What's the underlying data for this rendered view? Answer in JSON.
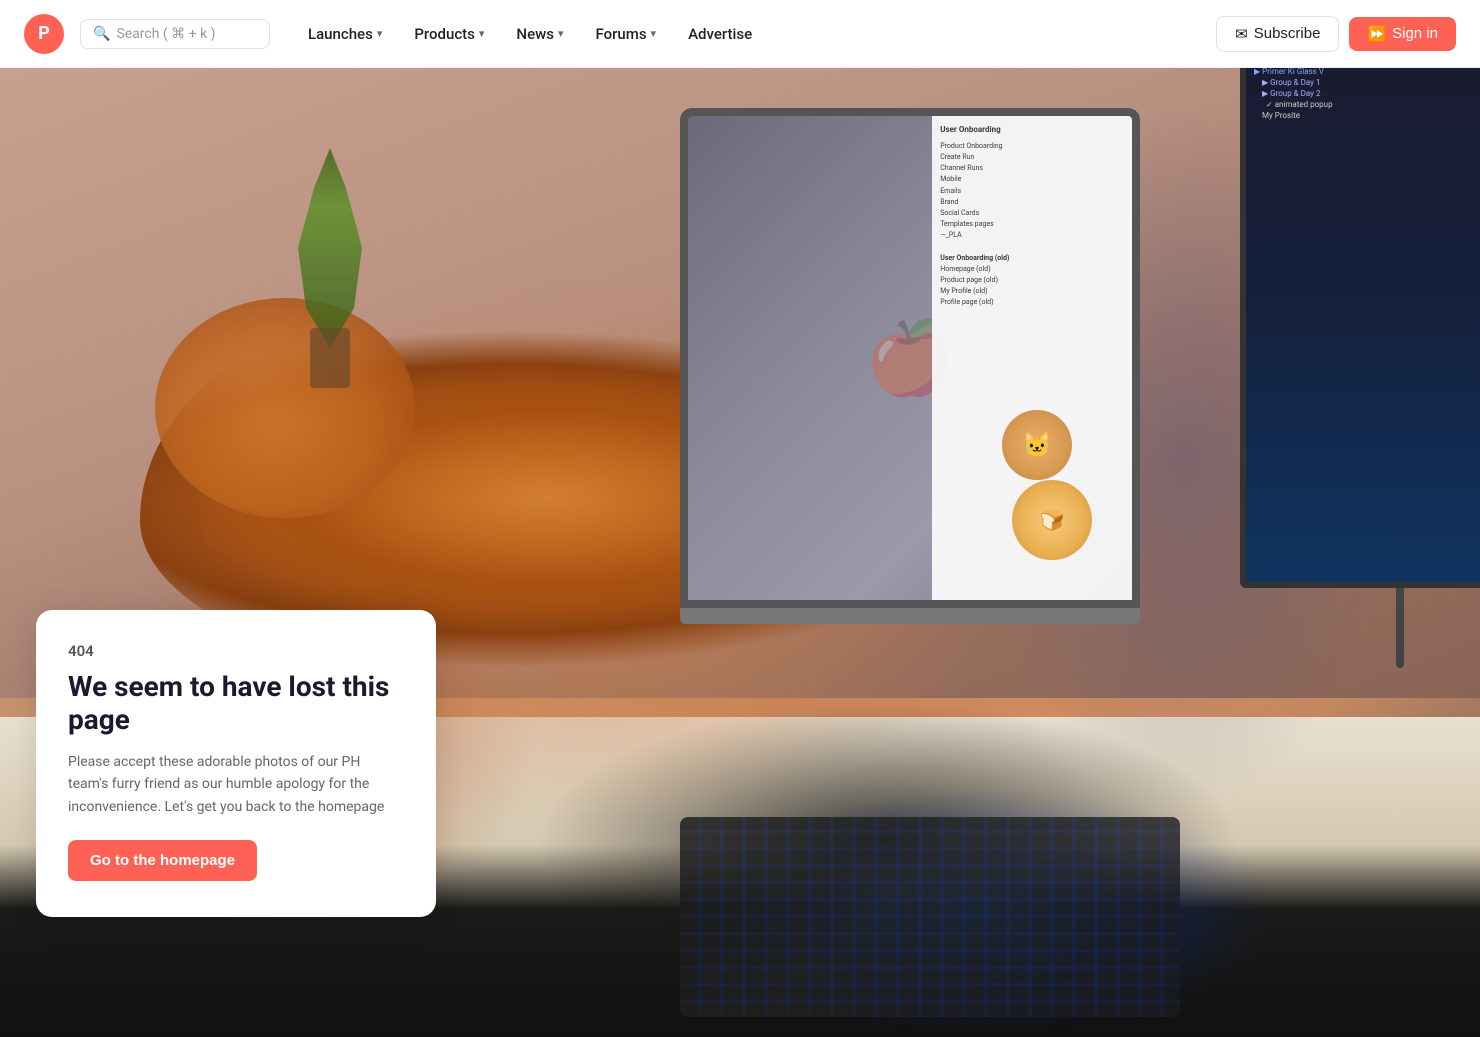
{
  "logo": {
    "letter": "P",
    "color": "#ff6154"
  },
  "search": {
    "placeholder": "Search ( ⌘ + k )",
    "icon": "🔍"
  },
  "nav": {
    "items": [
      {
        "label": "Launches",
        "has_dropdown": true
      },
      {
        "label": "Products",
        "has_dropdown": true
      },
      {
        "label": "News",
        "has_dropdown": true
      },
      {
        "label": "Forums",
        "has_dropdown": true
      },
      {
        "label": "Advertise",
        "has_dropdown": false
      }
    ]
  },
  "auth": {
    "subscribe_label": "Subscribe",
    "signin_label": "Sign in"
  },
  "error": {
    "code": "404",
    "title": "We seem to have lost this page",
    "description": "Please accept these adorable photos of our PH team's furry friend as our humble apology for the inconvenience. Let's get you back to the homepage",
    "cta_label": "Go to the homepage"
  }
}
